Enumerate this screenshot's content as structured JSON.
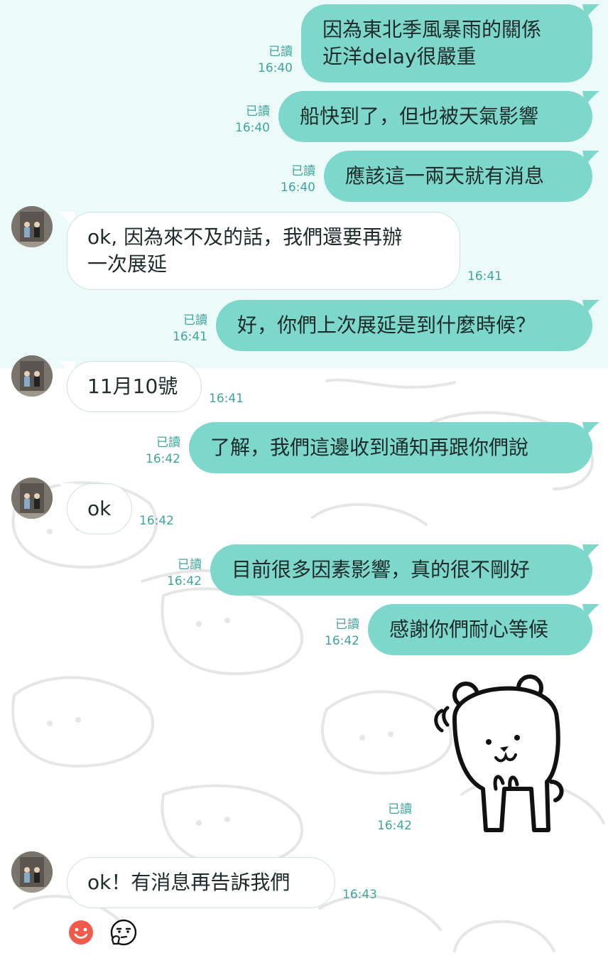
{
  "chat": {
    "messages": [
      {
        "dir": "out",
        "text": "因為東北季風暴雨的關係\n近洋delay很嚴重",
        "read": "已讀",
        "time": "16:40"
      },
      {
        "dir": "out",
        "text": "船快到了，但也被天氣影響",
        "read": "已讀",
        "time": "16:40"
      },
      {
        "dir": "out",
        "text": "應該這一兩天就有消息",
        "read": "已讀",
        "time": "16:40"
      },
      {
        "dir": "in",
        "text": "ok, 因為來不及的話，我們還要再辦\n一次展延",
        "time": "16:41"
      },
      {
        "dir": "out",
        "text": "好，你們上次展延是到什麼時候？",
        "read": "已讀",
        "time": "16:41"
      },
      {
        "dir": "in",
        "text": "11月10號",
        "time": "16:41"
      },
      {
        "dir": "out",
        "text": "了解，我們這邊收到通知再跟你們說",
        "read": "已讀",
        "time": "16:42"
      },
      {
        "dir": "in",
        "text": "ok",
        "time": "16:42"
      },
      {
        "dir": "out",
        "text": "目前很多因素影響，真的很不剛好",
        "read": "已讀",
        "time": "16:42"
      },
      {
        "dir": "out",
        "text": "感謝你們耐心等候",
        "read": "已讀",
        "time": "16:42"
      },
      {
        "dir": "out",
        "type": "sticker",
        "sticker": "white-bear-sticker",
        "read": "已讀",
        "time": "16:42"
      },
      {
        "dir": "in",
        "text": "ok！有消息再告訴我們",
        "time": "16:43"
      }
    ],
    "reactions": [
      "smile-reaction-icon",
      "thinking-face-icon"
    ]
  },
  "colors": {
    "outgoing_bubble": "#7dd7cb",
    "incoming_bubble": "#ffffff",
    "top_background": "#ecfafa",
    "meta_text": "#3fa59b"
  }
}
